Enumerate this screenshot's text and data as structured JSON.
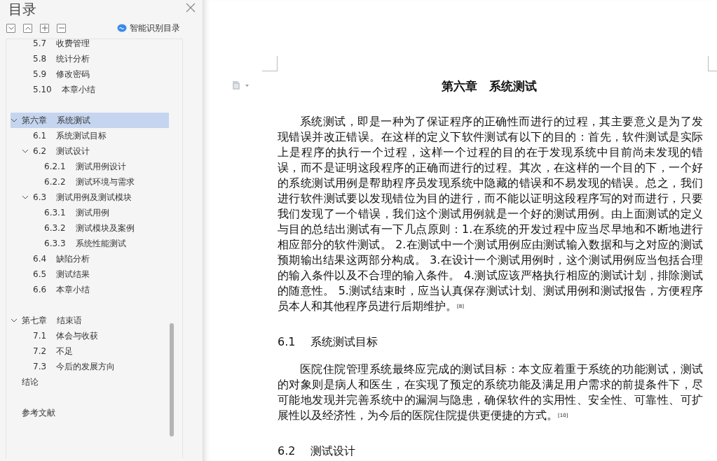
{
  "sidebar": {
    "title": "目录",
    "smart_button": "智能识别目录",
    "tree": [
      {
        "children": [
          {
            "number": "5.7",
            "title": "收费管理",
            "selected": false
          },
          {
            "number": "5.8",
            "title": "统计分析",
            "selected": false
          },
          {
            "number": "5.9",
            "title": "修改密码",
            "selected": false
          },
          {
            "number": "5.10",
            "title": "本章小结",
            "selected": false
          }
        ]
      },
      {
        "number": "第六章",
        "title": "系统测试",
        "spaced": true,
        "selected": true,
        "expanded": true,
        "children": [
          {
            "number": "6.1",
            "title": "系统测试目标",
            "selected": false
          },
          {
            "number": "6.2",
            "title": "测试设计",
            "selected": false,
            "expanded": true,
            "children": [
              {
                "number": "6.2.1",
                "title": "测试用例设计",
                "selected": false
              },
              {
                "number": "6.2.2",
                "title": "测试环境与需求",
                "selected": false
              }
            ]
          },
          {
            "number": "6.3",
            "title": "测试用例及测试模块",
            "selected": false,
            "expanded": true,
            "children": [
              {
                "number": "6.3.1",
                "title": "测试用例",
                "selected": false
              },
              {
                "number": "6.3.2",
                "title": "测试模块及案例",
                "selected": false
              },
              {
                "number": "6.3.3",
                "title": "系统性能测试",
                "selected": false
              }
            ]
          },
          {
            "number": "6.4",
            "title": "缺陷分析",
            "selected": false
          },
          {
            "number": "6.5",
            "title": "测试结果",
            "selected": false
          },
          {
            "number": "6.6",
            "title": "本章小结",
            "selected": false
          }
        ]
      },
      {
        "number": "第七章",
        "title": "结束语",
        "spaced": true,
        "selected": false,
        "expanded": true,
        "children": [
          {
            "number": "7.1",
            "title": "体会与收获",
            "selected": false
          },
          {
            "number": "7.2",
            "title": "不足",
            "selected": false
          },
          {
            "number": "7.3",
            "title": "今后的发展方向",
            "selected": false
          }
        ]
      },
      {
        "title": "结论",
        "spaced": false,
        "selected": false
      },
      {
        "title": "参考文献",
        "spaced": true,
        "selected": false
      }
    ]
  },
  "document": {
    "blocks": [
      {
        "kind": "chapter",
        "text": "第六章　系统测试"
      },
      {
        "kind": "paragraph",
        "text": "系统测试，即是一种为了保证程序的正确性而进行的过程，其主要意义是为了发现错误并改正错误。在这样的定义下软件测试有以下的目的：首先，软件测试是实际上是程序的执行一个过程，这样一个过程的目的在于发现系统中目前尚未发现的错误，而不是证明这段程序的正确而进行的过程。其次，在这样的一个目的下，一个好的系统测试用例是帮助程序员发现系统中隐藏的错误和不易发现的错误。总之，我们进行软件测试要以发现错位为目的进行，而不能以证明这段程序写的对而进行，只要我们发现了一个错误，我们这个测试用例就是一个好的测试用例。由上面测试的定义与目的总结出测试有一下几点原则：1.在系统的开发过程中应当尽早地和不断地进行相应部分的软件测试。 2.在测试中一个测试用例应由测试输入数据和与之对应的测试预期输出结果这两部分构成。 3.在设计一个测试用例时，这个测试用例应当包括合理的输入条件以及不合理的输入条件。 4.测试应该严格执行相应的测试计划，排除测试的随意性。 5.测试结束时，应当认真保存测试计划、测试用例和测试报告，方便程序员本人和其他程序员进行后期维护。$^{[8]}$"
      },
      {
        "kind": "section",
        "number": "6.1",
        "text": "系统测试目标"
      },
      {
        "kind": "paragraph",
        "text": "医院住院管理系统最终应完成的测试目标：本文应着重于系统的功能测试，测试的对象则是病人和医生，在实现了预定的系统功能及满足用户需求的前提条件下，尽可能地发现并完善系统中的漏洞与隐患，确保软件的实用性、安全性、可靠性、可扩展性以及经济性，为今后的医院住院提供更便捷的方式。$^{[10]}$"
      },
      {
        "kind": "section",
        "number": "6.2",
        "text": "测试设计"
      }
    ]
  }
}
